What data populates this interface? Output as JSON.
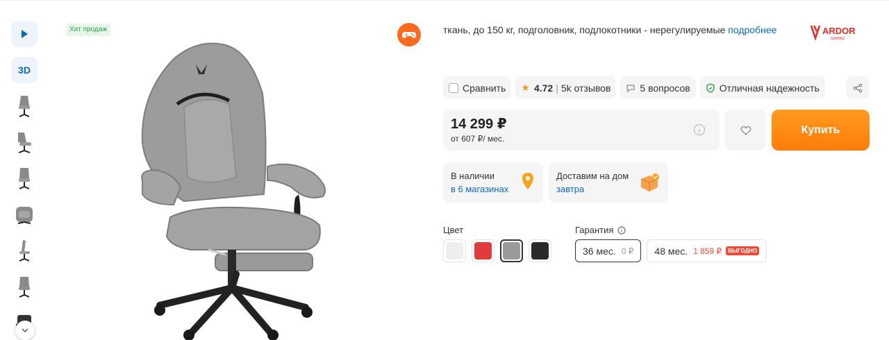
{
  "thumbnails": {
    "video_label": "video",
    "three_d_label": "3D",
    "count": 7
  },
  "badge": {
    "hit": "Хит продаж"
  },
  "product": {
    "description": "ткань, до 150 кг, подголовник, подлокотники - нерегулируемые",
    "more_link": "подробнее",
    "brand_logo_text": "ARDOR GAMING"
  },
  "actions": {
    "compare": "Сравнить",
    "rating": "4.72",
    "reviews": "5k отзывов",
    "questions": "5 вопросов",
    "reliability": "Отличная надежность"
  },
  "price": {
    "value": "14 299 ₽",
    "installment": "от 607 ₽/ мес.",
    "buy_label": "Купить"
  },
  "availability": {
    "stores_title": "В наличии",
    "stores_link": "в 6 магазинах",
    "delivery_title": "Доставим на дом",
    "delivery_link": "завтра"
  },
  "options": {
    "color_label": "Цвет",
    "colors": [
      "#eeeeee",
      "#e03c3c",
      "#9a9a9a",
      "#2b2b2b"
    ],
    "selected_color_index": 2,
    "warranty_label": "Гарантия",
    "warranty": [
      {
        "term": "36 мес.",
        "price": "0 ₽"
      },
      {
        "term": "48 мес.",
        "price": "1 859 ₽",
        "badge": "ВЫГОДНО"
      }
    ]
  },
  "colors": {
    "accent": "#ff8a12",
    "link": "#0a68c2",
    "badge_red": "#f04a36"
  }
}
